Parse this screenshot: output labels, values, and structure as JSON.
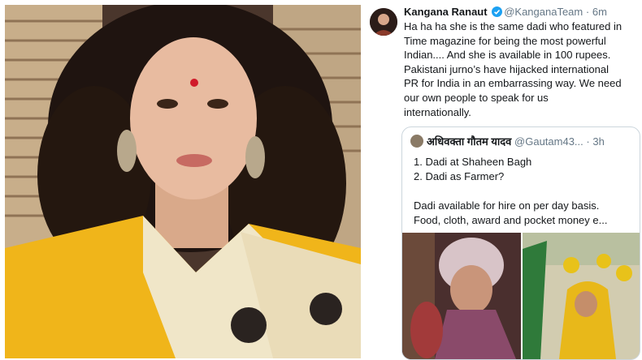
{
  "tweet": {
    "name": "Kangana Ranaut",
    "handle": "@KanganaTeam",
    "separator": "·",
    "time": "6m",
    "text": "Ha ha ha she is the same dadi who featured in\nTime magazine for being the most powerful\nIndian.... And she is available in 100 rupees.\nPakistani jurno’s have hijacked international\nPR for India in an embarrassing way. We need\nour own people to speak for us\ninternationally.",
    "verified_icon": "verified-badge-icon",
    "colors": {
      "accent": "#1da1f2",
      "text": "#14171a",
      "muted": "#657786",
      "border": "#ccd6dd"
    }
  },
  "quote": {
    "name": "अधिवक्ता गौतम यादव",
    "handle": "@Gautam43...",
    "separator": "·",
    "time": "3h",
    "line1": "1. Dadi at Shaheen Bagh",
    "line2": "2. Dadi as Farmer?",
    "line3": "Dadi available for hire on per day basis.",
    "line4": "Food, cloth, award and pocket money e..."
  }
}
